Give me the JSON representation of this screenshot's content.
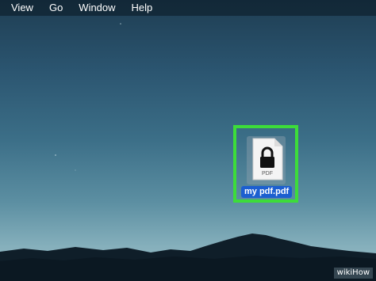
{
  "menubar": {
    "items": [
      {
        "label": "View"
      },
      {
        "label": "Go"
      },
      {
        "label": "Window"
      },
      {
        "label": "Help"
      }
    ]
  },
  "desktop_file": {
    "name": "my pdf.pdf",
    "type_label": "PDF",
    "icon": "locked-pdf-document-icon",
    "selected": true,
    "highlight_color": "#3ddc3a",
    "label_bg_color": "#1c5fd0"
  },
  "watermark": {
    "text": "wikiHow"
  }
}
